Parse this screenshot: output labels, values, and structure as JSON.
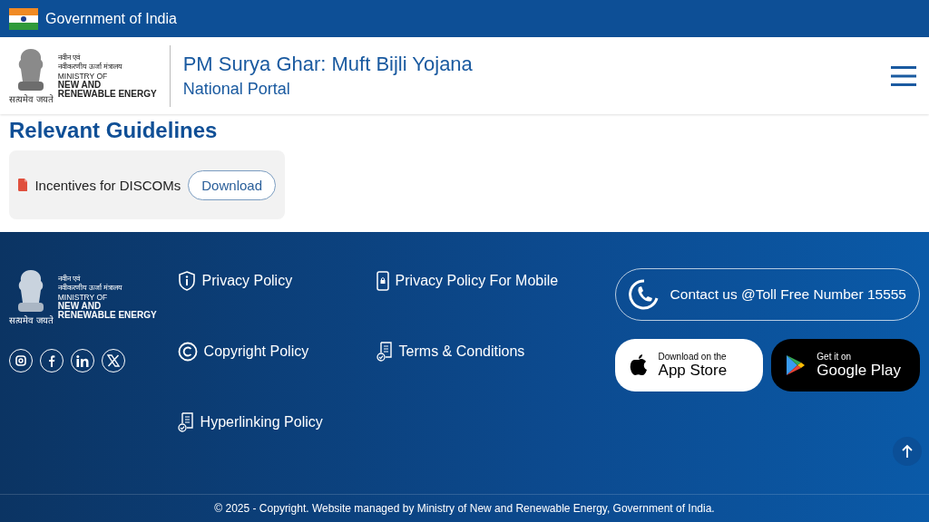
{
  "top_bar": {
    "label": "Government of India"
  },
  "header": {
    "ministry_logo": {
      "lines": [
        {
          "text": "नवीन एवं",
          "kind": "hindi"
        },
        {
          "text": "नवीकरणीय ऊर्जा मंत्रालय",
          "kind": "hindi"
        },
        {
          "text": "MINISTRY OF",
          "kind": "plain"
        },
        {
          "text": "NEW AND",
          "kind": "bold"
        },
        {
          "text": "RENEWABLE ENERGY",
          "kind": "bold"
        }
      ],
      "motto": "सत्यमेव जयते"
    },
    "title": "PM Surya Ghar: Muft Bijli Yojana",
    "subtitle": "National Portal"
  },
  "section": {
    "heading": "Relevant Guidelines",
    "documents": [
      {
        "name": "Incentives for DISCOMs",
        "action": "Download"
      }
    ]
  },
  "footer": {
    "ministry_logo": {
      "lines": [
        {
          "text": "नवीन एवं",
          "kind": "hindi"
        },
        {
          "text": "नवीकरणीय ऊर्जा मंत्रालय",
          "kind": "hindi"
        },
        {
          "text": "MINISTRY OF",
          "kind": "plain"
        },
        {
          "text": "NEW AND",
          "kind": "bold"
        },
        {
          "text": "RENEWABLE ENERGY",
          "kind": "bold"
        }
      ],
      "motto": "सत्यमेव जयते"
    },
    "social": [
      {
        "kind": "instagram"
      },
      {
        "kind": "facebook"
      },
      {
        "kind": "linkedin"
      },
      {
        "kind": "x"
      }
    ],
    "links": [
      {
        "label": "Privacy Policy",
        "kind": "privacy"
      },
      {
        "label": "Privacy Policy For Mobile",
        "kind": "mobile"
      },
      {
        "label": "Copyright Policy",
        "kind": "copyright"
      },
      {
        "label": "Terms & Conditions",
        "kind": "terms"
      },
      {
        "label": "Hyperlinking Policy",
        "kind": "hyperlink"
      }
    ],
    "contact": "Contact us @Toll Free Number 15555",
    "app_buttons": [
      {
        "kind": "apple",
        "small": "Download on the",
        "big": "App Store"
      },
      {
        "kind": "google",
        "small": "Get it on",
        "big": "Google Play"
      }
    ],
    "copyright": "© 2025 - Copyright. Website managed by Ministry of New and Renewable Energy, Government of India."
  }
}
